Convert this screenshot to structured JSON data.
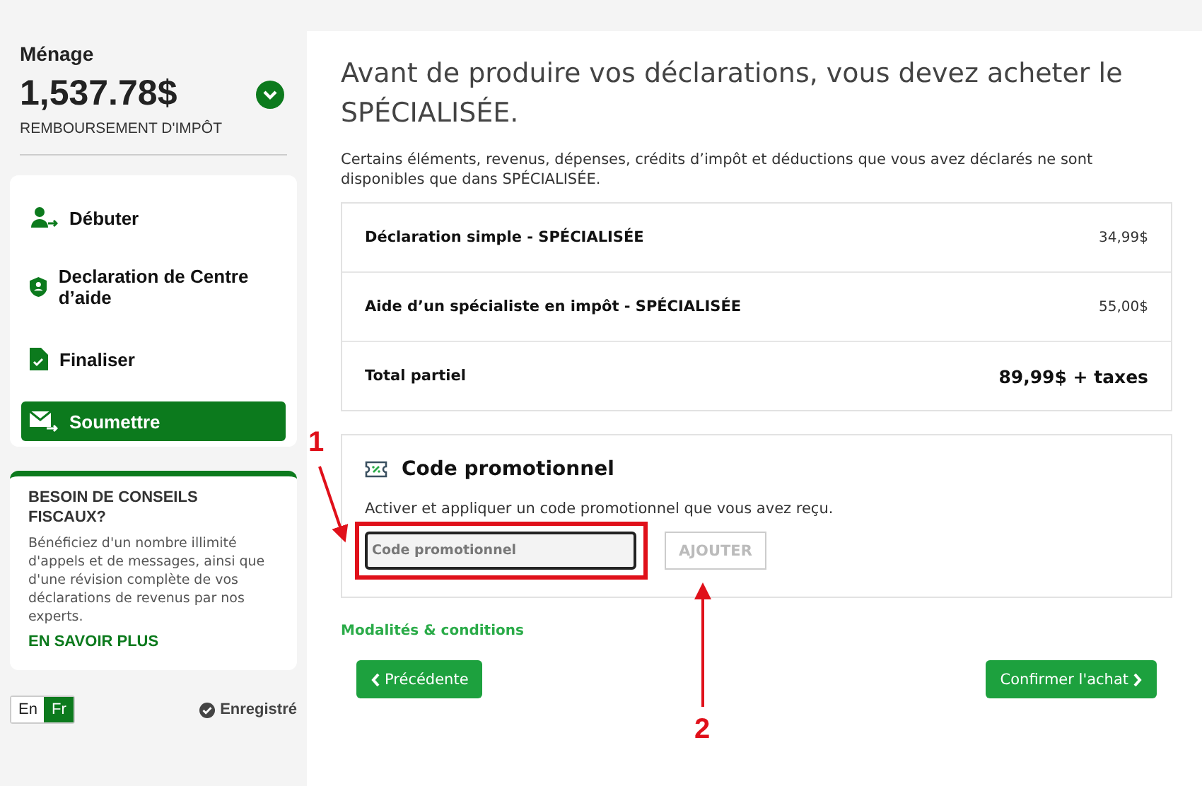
{
  "summary": {
    "household": "Ménage",
    "amount": "1,537.78$",
    "caption": "REMBOURSEMENT D'IMPÔT"
  },
  "nav": [
    {
      "label": "Débuter",
      "selected": false
    },
    {
      "label": "Declaration de Centre d’aide",
      "selected": false
    },
    {
      "label": "Finaliser",
      "selected": false
    },
    {
      "label": "Soumettre",
      "selected": true
    }
  ],
  "tips": {
    "title": "BESOIN DE CONSEILS FISCAUX?",
    "body": "Bénéficiez d'un nombre illimité d'appels et de messages, ainsi que d'une révision complète de vos déclarations de revenus par nos experts.",
    "link": "EN SAVOIR PLUS"
  },
  "language": [
    {
      "label": "En",
      "selected": false
    },
    {
      "label": "Fr",
      "selected": true
    }
  ],
  "save_status": "Enregistré",
  "heading": "Avant de produire vos déclarations, vous devez acheter le SPÉCIALISÉE.",
  "intro": "Certains éléments, revenus, dépenses, crédits d’impôt et déductions que vous avez déclarés ne sont disponibles que dans SPÉCIALISÉE.",
  "items": [
    {
      "label": "Déclaration simple - SPÉCIALISÉE",
      "price": "34,99$"
    },
    {
      "label": "Aide d’un spécialiste en impôt - SPÉCIALISÉE",
      "price": "55,00$"
    }
  ],
  "subtotal": {
    "label": "Total partiel",
    "price": "89,99$ + taxes"
  },
  "promo": {
    "title": "Code promotionnel",
    "description": "Activer et appliquer un code promotionnel que vous avez reçu.",
    "placeholder": "Code promotionnel",
    "button": "AJOUTER",
    "button_disabled": true
  },
  "terms_link": "Modalités & conditions",
  "back_button": "Précédente",
  "confirm_button": "Confirmer l'achat",
  "annotations": [
    {
      "label": "1"
    },
    {
      "label": "2"
    }
  ]
}
